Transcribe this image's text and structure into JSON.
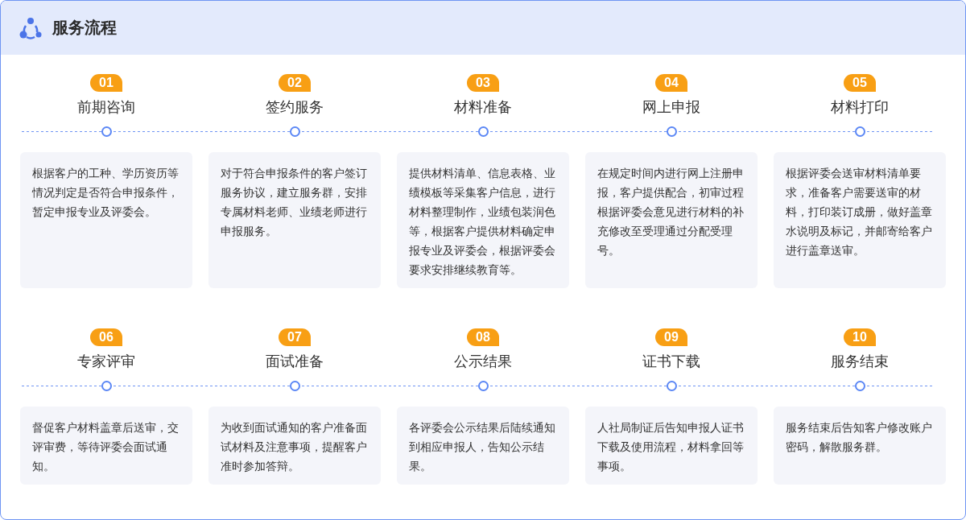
{
  "header": {
    "title": "服务流程"
  },
  "steps": [
    {
      "number": "01",
      "title": "前期咨询",
      "description": "根据客户的工种、学历资历等情况判定是否符合申报条件，暂定申报专业及评委会。"
    },
    {
      "number": "02",
      "title": "签约服务",
      "description": "对于符合申报条件的客户签订服务协议，建立服务群，安排专属材料老师、业绩老师进行申报服务。"
    },
    {
      "number": "03",
      "title": "材料准备",
      "description": "提供材料清单、信息表格、业绩模板等采集客户信息，进行材料整理制作，业绩包装润色等，根据客户提供材料确定申报专业及评委会，根据评委会要求安排继续教育等。"
    },
    {
      "number": "04",
      "title": "网上申报",
      "description": "在规定时间内进行网上注册申报，客户提供配合，初审过程根据评委会意见进行材料的补充修改至受理通过分配受理号。"
    },
    {
      "number": "05",
      "title": "材料打印",
      "description": "根据评委会送审材料清单要求，准备客户需要送审的材料，打印装订成册，做好盖章水说明及标记，并邮寄给客户进行盖章送审。"
    },
    {
      "number": "06",
      "title": "专家评审",
      "description": "督促客户材料盖章后送审，交评审费，等待评委会面试通知。"
    },
    {
      "number": "07",
      "title": "面试准备",
      "description": "为收到面试通知的客户准备面试材料及注意事项，提醒客户准时参加答辩。"
    },
    {
      "number": "08",
      "title": "公示结果",
      "description": "各评委会公示结果后陆续通知到相应申报人，告知公示结果。"
    },
    {
      "number": "09",
      "title": "证书下载",
      "description": "人社局制证后告知申报人证书下载及使用流程，材料拿回等事项。"
    },
    {
      "number": "10",
      "title": "服务结束",
      "description": "服务结束后告知客户修改账户密码，解散服务群。"
    }
  ]
}
